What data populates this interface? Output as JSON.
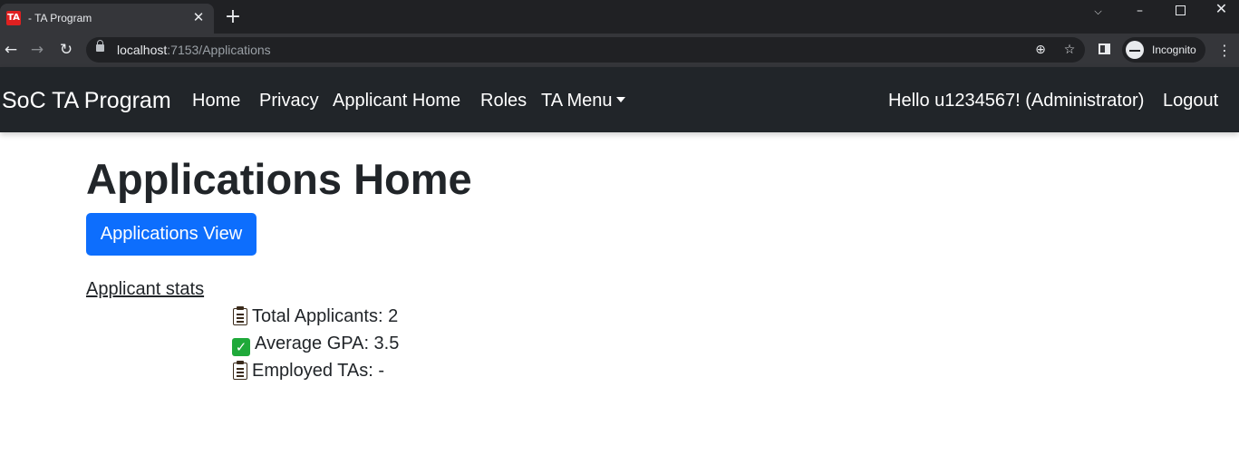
{
  "browser": {
    "tab_favicon": "TA",
    "tab_title": "- TA Program",
    "url_host": "localhost",
    "url_rest": ":7153/Applications",
    "incognito_label": "Incognito"
  },
  "navbar": {
    "brand": "SoC TA Program",
    "links": [
      "Home",
      "Privacy",
      "Applicant Home",
      "Roles",
      "TA Menu"
    ],
    "greeting": "Hello u1234567! (Administrator)",
    "logout": "Logout"
  },
  "main": {
    "title": "Applications Home",
    "view_button": "Applications View",
    "stats_heading": "Applicant stats",
    "stats": [
      {
        "icon": "clipboard-icon",
        "text": "Total Applicants: 2"
      },
      {
        "icon": "check-mark-icon",
        "text": "Average GPA: 3.5"
      },
      {
        "icon": "clipboard-icon",
        "text": "Employed TAs: -"
      }
    ]
  },
  "colors": {
    "navbar_bg": "#212529",
    "primary_button": "#0d6efd",
    "check_green": "#1fa93a",
    "favicon_red": "#e02020"
  }
}
